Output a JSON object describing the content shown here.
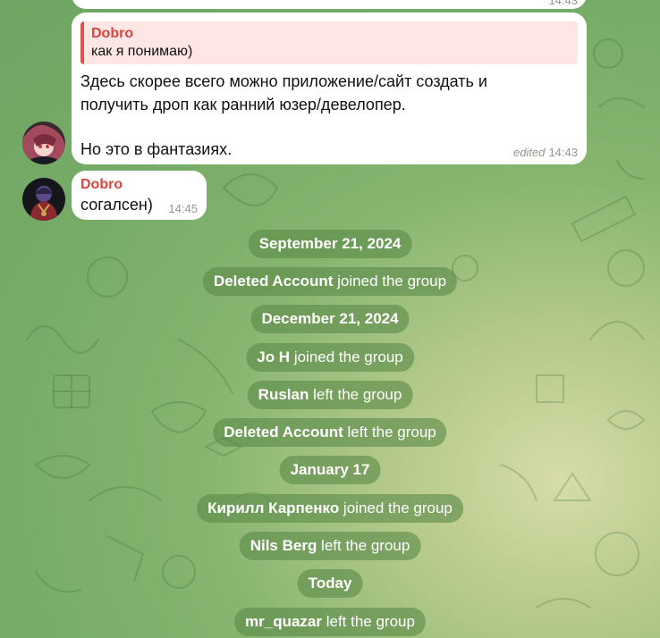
{
  "chat": {
    "top_clipped_time": "14:43",
    "message1": {
      "quote_sender": "Dobro",
      "quote_text": "как я понимаю)",
      "line1": "Здесь скорее всего можно приложение/сайт создать и",
      "line2": "получить дроп как ранний юзер/девелопер.",
      "line3": "Но это в фантазиях.",
      "edited_label": "edited",
      "time": "14:43"
    },
    "message2": {
      "sender": "Dobro",
      "text": "согалсен)",
      "time": "14:45"
    }
  },
  "service_messages": [
    {
      "bold": "September 21, 2024",
      "rest": ""
    },
    {
      "bold": "Deleted Account",
      "rest": " joined the group"
    },
    {
      "bold": "December 21, 2024",
      "rest": ""
    },
    {
      "bold": "Jo H",
      "rest": " joined the group"
    },
    {
      "bold": "Ruslan",
      "rest": " left the group"
    },
    {
      "bold": "Deleted Account",
      "rest": " left the group"
    },
    {
      "bold": "January 17",
      "rest": ""
    },
    {
      "bold": "Кирилл Карпенко",
      "rest": " joined the group"
    },
    {
      "bold": "Nils Berg",
      "rest": " left the group"
    },
    {
      "bold": "Today",
      "rest": ""
    },
    {
      "bold": "mr_quazar",
      "rest": " left the group"
    }
  ],
  "colors": {
    "sender": "#d9453f",
    "quote_bar": "#e0524d",
    "service_pill": "#5c8a48"
  }
}
